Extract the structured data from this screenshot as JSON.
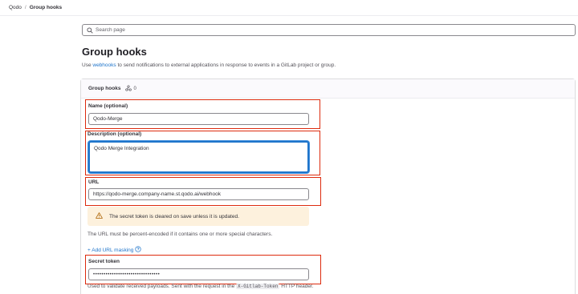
{
  "breadcrumb": {
    "items": [
      "Qodo",
      "Group hooks"
    ],
    "separator": "/"
  },
  "search": {
    "placeholder": "Search page",
    "icon": "search-icon"
  },
  "page": {
    "title": "Group hooks",
    "description_prefix": "Use ",
    "description_link": "webhooks",
    "description_suffix": " to send notifications to external applications in response to events in a GitLab project or group."
  },
  "card": {
    "title": "Group hooks",
    "count": "0",
    "count_icon": "webhook-icon"
  },
  "form": {
    "name_label": "Name (optional)",
    "name_value": "Qodo-Merge",
    "description_label": "Description (optional)",
    "description_value": "Qodo Merge Integration",
    "url_label": "URL",
    "url_value": "https://qodo-merge.company-name.st.qodo.ai/webhook",
    "alert_text": "The secret token is cleared on save unless it is updated.",
    "url_help": "The URL must be percent-encoded if it contains one or more special characters.",
    "add_masking_label": "+ Add URL masking",
    "secret_label": "Secret token",
    "secret_value": "••••••••••••••••••••••••••••••••",
    "secret_help_prefix": "Used to validate received payloads. Sent with the request in the ",
    "secret_help_code": "X-Gitlab-Token",
    "secret_help_suffix": " HTTP header."
  },
  "colors": {
    "highlight": "#dd2b0e",
    "link": "#1f75cb",
    "alert_bg": "#fdf1dd",
    "warning": "#ab6100"
  }
}
